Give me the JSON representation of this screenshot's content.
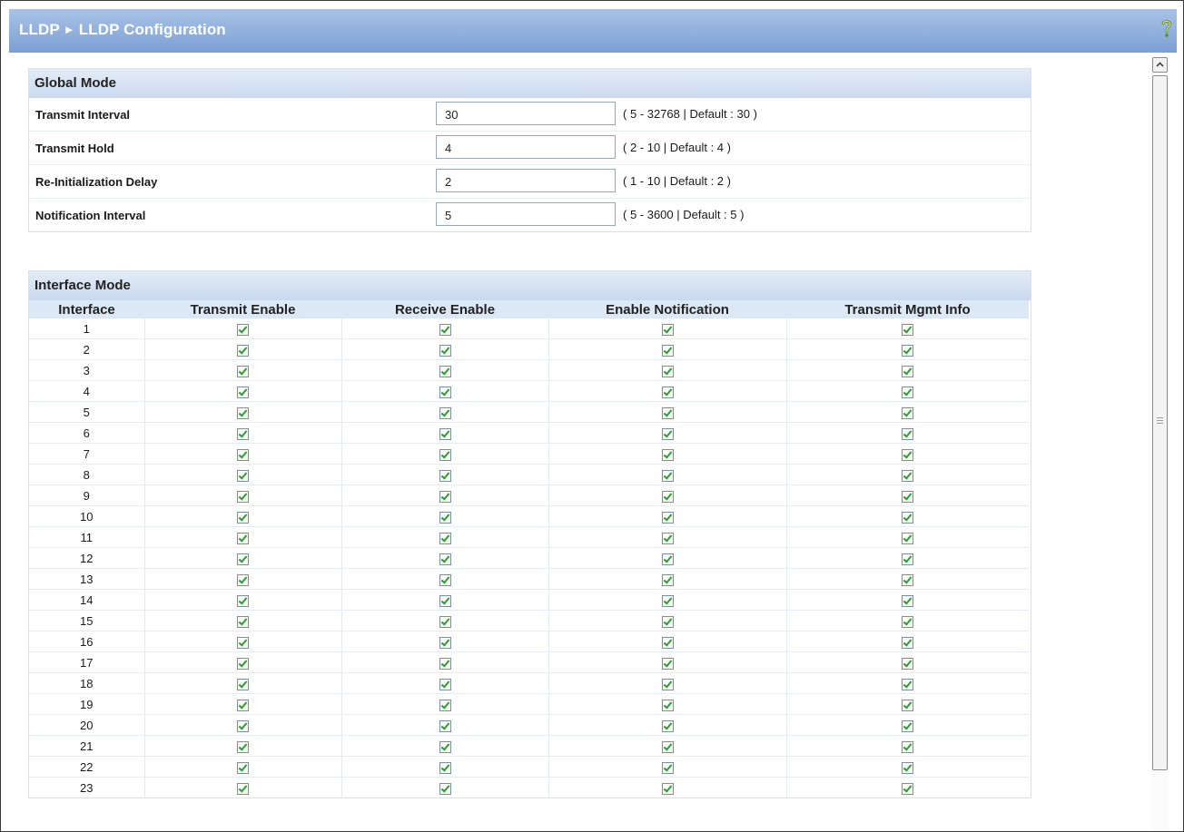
{
  "header": {
    "breadcrumb_root": "LLDP",
    "breadcrumb_separator": "►",
    "breadcrumb_page": "LLDP Configuration",
    "help_icon": "help-question-icon"
  },
  "global_mode": {
    "title": "Global Mode",
    "rows": [
      {
        "label": "Transmit Interval",
        "value": "30",
        "range": "( 5 - 32768 | Default : 30 )"
      },
      {
        "label": "Transmit Hold",
        "value": "4",
        "range": "( 2 - 10 | Default : 4 )"
      },
      {
        "label": "Re-Initialization Delay",
        "value": "2",
        "range": "( 1 - 10 | Default : 2 )"
      },
      {
        "label": "Notification Interval",
        "value": "5",
        "range": "( 5 - 3600 | Default : 5 )"
      }
    ]
  },
  "interface_mode": {
    "title": "Interface Mode",
    "columns": [
      "Interface",
      "Transmit Enable",
      "Receive Enable",
      "Enable Notification",
      "Transmit Mgmt Info"
    ],
    "rows": [
      {
        "interface": "1",
        "transmit_enable": true,
        "receive_enable": true,
        "enable_notification": true,
        "transmit_mgmt_info": true
      },
      {
        "interface": "2",
        "transmit_enable": true,
        "receive_enable": true,
        "enable_notification": true,
        "transmit_mgmt_info": true
      },
      {
        "interface": "3",
        "transmit_enable": true,
        "receive_enable": true,
        "enable_notification": true,
        "transmit_mgmt_info": true
      },
      {
        "interface": "4",
        "transmit_enable": true,
        "receive_enable": true,
        "enable_notification": true,
        "transmit_mgmt_info": true
      },
      {
        "interface": "5",
        "transmit_enable": true,
        "receive_enable": true,
        "enable_notification": true,
        "transmit_mgmt_info": true
      },
      {
        "interface": "6",
        "transmit_enable": true,
        "receive_enable": true,
        "enable_notification": true,
        "transmit_mgmt_info": true
      },
      {
        "interface": "7",
        "transmit_enable": true,
        "receive_enable": true,
        "enable_notification": true,
        "transmit_mgmt_info": true
      },
      {
        "interface": "8",
        "transmit_enable": true,
        "receive_enable": true,
        "enable_notification": true,
        "transmit_mgmt_info": true
      },
      {
        "interface": "9",
        "transmit_enable": true,
        "receive_enable": true,
        "enable_notification": true,
        "transmit_mgmt_info": true
      },
      {
        "interface": "10",
        "transmit_enable": true,
        "receive_enable": true,
        "enable_notification": true,
        "transmit_mgmt_info": true
      },
      {
        "interface": "11",
        "transmit_enable": true,
        "receive_enable": true,
        "enable_notification": true,
        "transmit_mgmt_info": true
      },
      {
        "interface": "12",
        "transmit_enable": true,
        "receive_enable": true,
        "enable_notification": true,
        "transmit_mgmt_info": true
      },
      {
        "interface": "13",
        "transmit_enable": true,
        "receive_enable": true,
        "enable_notification": true,
        "transmit_mgmt_info": true
      },
      {
        "interface": "14",
        "transmit_enable": true,
        "receive_enable": true,
        "enable_notification": true,
        "transmit_mgmt_info": true
      },
      {
        "interface": "15",
        "transmit_enable": true,
        "receive_enable": true,
        "enable_notification": true,
        "transmit_mgmt_info": true
      },
      {
        "interface": "16",
        "transmit_enable": true,
        "receive_enable": true,
        "enable_notification": true,
        "transmit_mgmt_info": true
      },
      {
        "interface": "17",
        "transmit_enable": true,
        "receive_enable": true,
        "enable_notification": true,
        "transmit_mgmt_info": true
      },
      {
        "interface": "18",
        "transmit_enable": true,
        "receive_enable": true,
        "enable_notification": true,
        "transmit_mgmt_info": true
      },
      {
        "interface": "19",
        "transmit_enable": true,
        "receive_enable": true,
        "enable_notification": true,
        "transmit_mgmt_info": true
      },
      {
        "interface": "20",
        "transmit_enable": true,
        "receive_enable": true,
        "enable_notification": true,
        "transmit_mgmt_info": true
      },
      {
        "interface": "21",
        "transmit_enable": true,
        "receive_enable": true,
        "enable_notification": true,
        "transmit_mgmt_info": true
      },
      {
        "interface": "22",
        "transmit_enable": true,
        "receive_enable": true,
        "enable_notification": true,
        "transmit_mgmt_info": true
      },
      {
        "interface": "23",
        "transmit_enable": true,
        "receive_enable": true,
        "enable_notification": true,
        "transmit_mgmt_info": true
      }
    ]
  },
  "colors": {
    "title_bar_top": "#a9c3e6",
    "title_bar_bottom": "#7b9fd3",
    "section_header": "#dde8f6",
    "check_green": "#2f9a36"
  }
}
